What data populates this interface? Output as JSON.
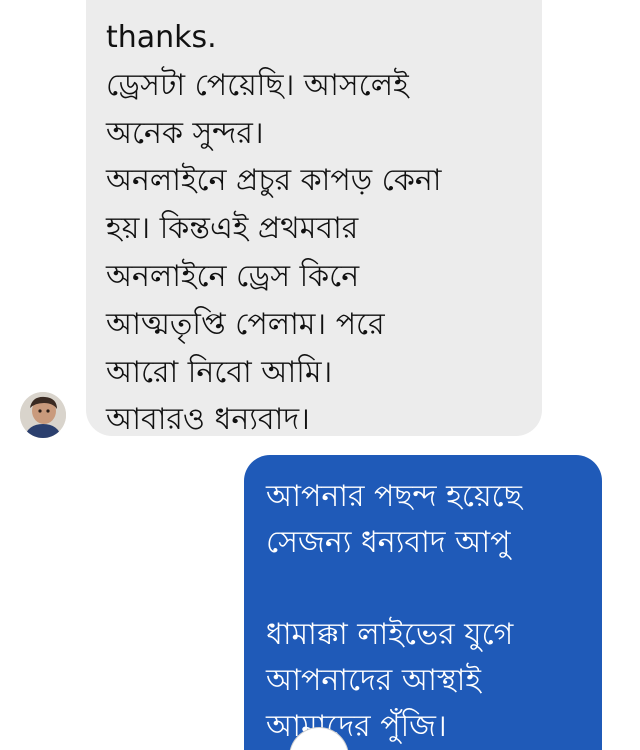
{
  "incoming_message": {
    "lines": [
      "thanks.",
      "ড্রেসটা পেয়েছি। আসলেই",
      "অনেক সুন্দর।",
      "অনলাইনে প্রচুর কাপড় কেনা",
      "হয়। কিন্তএই প্রথমবার",
      "অনলাইনে ড্রেস কিনে",
      "আত্মতৃপ্তি পেলাম। পরে",
      "আরো নিবো আমি।",
      "আবারও ধন্যবাদ।"
    ]
  },
  "outgoing_message": {
    "paragraph_1": [
      "আপনার পছন্দ হয়েছে",
      "সেজন্য ধন্যবাদ আপু"
    ],
    "paragraph_2": [
      "ধামাক্কা লাইভের যুগে",
      "আপনাদের আস্থাই",
      "আমাদের পুঁজি।"
    ]
  },
  "colors": {
    "incoming_bubble": "#ececec",
    "outgoing_bubble": "#1f5ab8"
  }
}
